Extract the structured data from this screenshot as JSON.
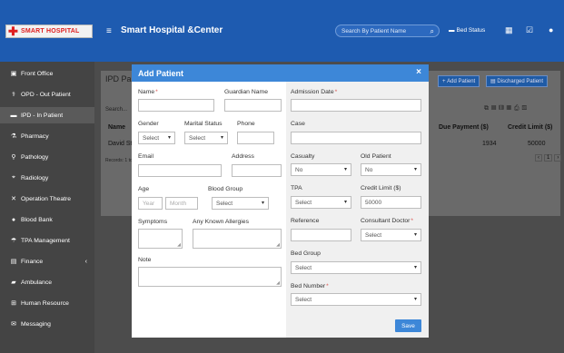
{
  "header": {
    "logo_text": "SMART HOSPITAL",
    "app_title": "Smart Hospital &Center",
    "search_placeholder": "Search By Patient Name",
    "bed_status": "Bed Status"
  },
  "sidebar": {
    "items": [
      {
        "label": "Front Office",
        "icon": "front-office-icon"
      },
      {
        "label": "OPD - Out Patient",
        "icon": "stethoscope-icon"
      },
      {
        "label": "IPD - In Patient",
        "icon": "bed-icon"
      },
      {
        "label": "Pharmacy",
        "icon": "mortar-pestle-icon"
      },
      {
        "label": "Pathology",
        "icon": "flask-icon"
      },
      {
        "label": "Radiology",
        "icon": "microscope-icon"
      },
      {
        "label": "Operation Theatre",
        "icon": "scissors-icon"
      },
      {
        "label": "Blood Bank",
        "icon": "drop-icon"
      },
      {
        "label": "TPA Management",
        "icon": "umbrella-icon"
      },
      {
        "label": "Finance",
        "icon": "money-icon"
      },
      {
        "label": "Ambulance",
        "icon": "ambulance-icon"
      },
      {
        "label": "Human Resource",
        "icon": "sitemap-icon"
      },
      {
        "label": "Messaging",
        "icon": "chat-icon"
      }
    ]
  },
  "main": {
    "title": "IPD Pa",
    "search_label": "Search...",
    "add_patient_btn": "Add Patient",
    "discharged_btn": "Discharged Patient",
    "columns": {
      "name": "Name",
      "due_payment": "Due Payment ($)",
      "credit_limit": "Credit Limit ($)"
    },
    "row": {
      "name": "David St",
      "due": "1934",
      "credit": "50000"
    },
    "records": "Records: 1 to 1 of 1",
    "page": "1"
  },
  "modal": {
    "title": "Add Patient",
    "close": "×",
    "save": "Save",
    "labels": {
      "name": "Name",
      "guardian": "Guardian Name",
      "gender": "Gender",
      "marital": "Marital Status",
      "phone": "Phone",
      "email": "Email",
      "address": "Address",
      "age": "Age",
      "blood_group": "Blood Group",
      "symptoms": "Symptoms",
      "allergies": "Any Known Allergies",
      "note": "Note",
      "admission_date": "Admission Date",
      "case": "Case",
      "casualty": "Casualty",
      "old_patient": "Old Patient",
      "tpa": "TPA",
      "credit_limit": "Credit Limit ($)",
      "reference": "Reference",
      "consultant": "Consultant Doctor",
      "bed_group": "Bed Group",
      "bed_number": "Bed Number"
    },
    "required_mark": "*",
    "values": {
      "gender": "Select",
      "marital": "Select",
      "age_year_ph": "Year",
      "age_month_ph": "Month",
      "blood_group": "Select",
      "casualty": "No",
      "old_patient": "No",
      "tpa": "Select",
      "credit_limit": "50000",
      "consultant": "Select",
      "bed_group": "Select",
      "bed_number": "Select"
    }
  }
}
